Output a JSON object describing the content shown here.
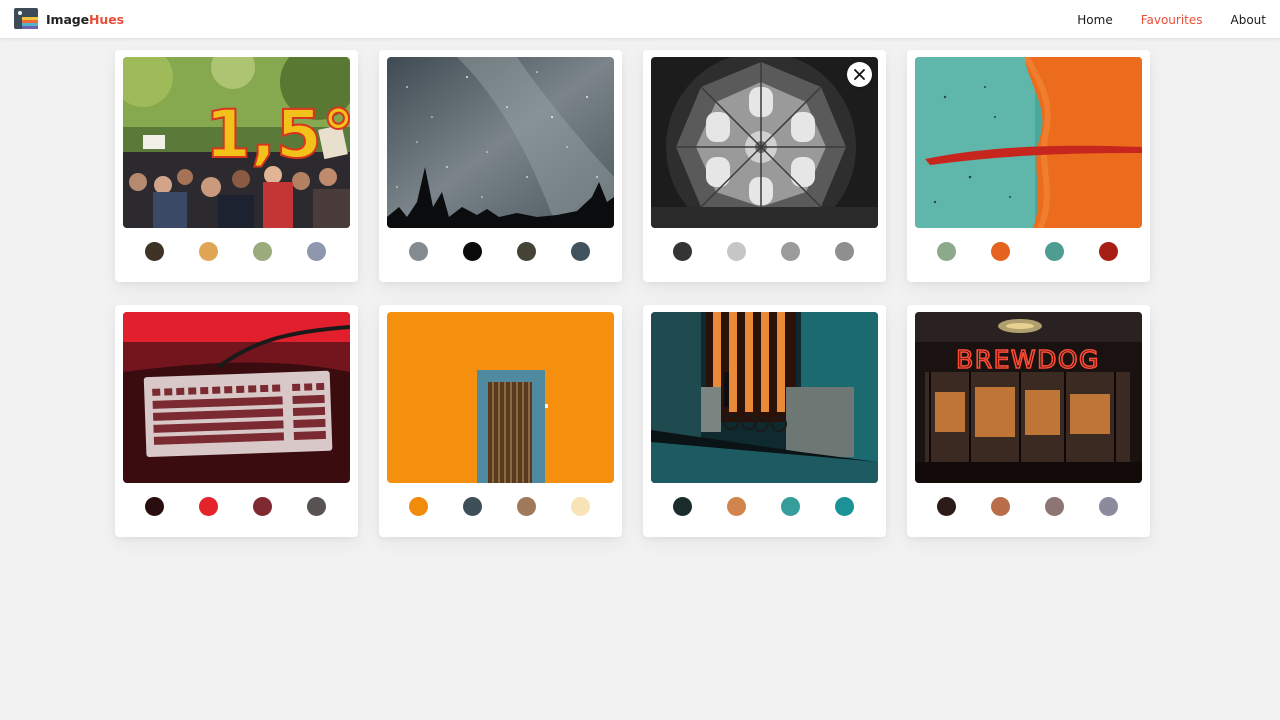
{
  "app": {
    "name_primary": "Image",
    "name_accent": "Hues",
    "accent_color": "#e8503a"
  },
  "nav": {
    "items": [
      {
        "label": "Home",
        "active": false
      },
      {
        "label": "Favourites",
        "active": true
      },
      {
        "label": "About",
        "active": false
      }
    ]
  },
  "cards": [
    {
      "image": "climate-protest-crowd",
      "palette": [
        "#3e3325",
        "#e0a656",
        "#9aab7c",
        "#8e97ae"
      ],
      "close_visible": false
    },
    {
      "image": "milky-way-forest",
      "palette": [
        "#838b91",
        "#0b0b0b",
        "#454336",
        "#3f525d"
      ],
      "close_visible": false
    },
    {
      "image": "cathedral-dome-bw",
      "palette": [
        "#343434",
        "#c6c6c6",
        "#9b9b9b",
        "#8f8f8f"
      ],
      "close_visible": true
    },
    {
      "image": "teal-orange-paint",
      "palette": [
        "#8ca98b",
        "#e4631e",
        "#4f9c93",
        "#a71f14"
      ],
      "close_visible": false
    },
    {
      "image": "keyboard-red-light",
      "palette": [
        "#2a0d0e",
        "#e4242a",
        "#7f2a31",
        "#585252"
      ],
      "close_visible": false
    },
    {
      "image": "blue-door-orange-wall",
      "palette": [
        "#f18b0c",
        "#3f4f57",
        "#a0785a",
        "#f8e4b6"
      ],
      "close_visible": false
    },
    {
      "image": "teal-street-night",
      "palette": [
        "#1a2c2c",
        "#d1854d",
        "#379d9b",
        "#1b9296"
      ],
      "close_visible": false
    },
    {
      "image": "brewdog-neon-bar",
      "palette": [
        "#2b1a18",
        "#b96d49",
        "#8d7573",
        "#8b8b9e"
      ],
      "close_visible": false
    }
  ],
  "photo_text": {
    "protest_sign": "1,5°",
    "neon_sign": "BREWDOG"
  },
  "close_icon": "close-icon"
}
